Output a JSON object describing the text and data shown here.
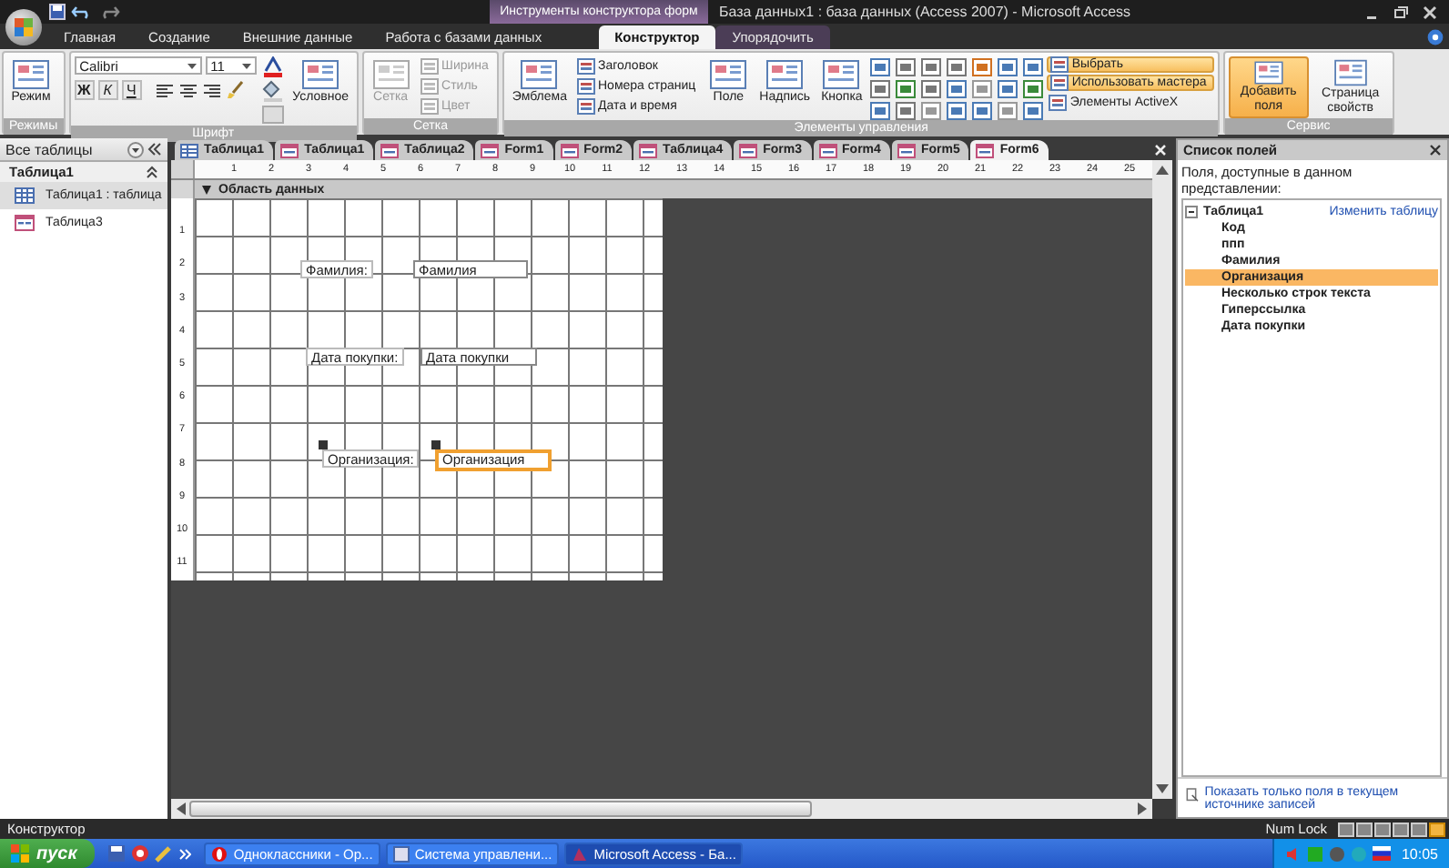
{
  "window": {
    "title": "База данных1 : база данных (Access 2007) - Microsoft Access",
    "contextual_group": "Инструменты конструктора форм"
  },
  "ribbon": {
    "tabs": [
      {
        "label": "Главная",
        "kind": "main",
        "selected": false
      },
      {
        "label": "Создание",
        "kind": "main",
        "selected": false
      },
      {
        "label": "Внешние данные",
        "kind": "main",
        "selected": false
      },
      {
        "label": "Работа с базами данных",
        "kind": "main",
        "selected": false
      },
      {
        "label": "Конструктор",
        "kind": "contextual",
        "selected": true
      },
      {
        "label": "Упорядочить",
        "kind": "contextual",
        "selected": false
      }
    ],
    "groups": [
      {
        "label": "Режимы",
        "items": [
          {
            "kind": "large",
            "label": "Режим",
            "on": false,
            "disabled": false
          }
        ]
      },
      {
        "label": "Шрифт",
        "items": [
          {
            "kind": "font",
            "font": "Calibri",
            "size": "11",
            "styles": [
              "Ж",
              "К",
              "Ч"
            ]
          },
          {
            "kind": "large",
            "label": "Условное",
            "on": false,
            "disabled": false
          }
        ]
      },
      {
        "label": "Сетка",
        "items": [
          {
            "kind": "large",
            "label": "Сетка",
            "on": false,
            "disabled": true
          },
          {
            "kind": "stack",
            "items": [
              {
                "label": "Ширина",
                "on": false,
                "disabled": true
              },
              {
                "label": "Стиль",
                "on": false,
                "disabled": true
              },
              {
                "label": "Цвет",
                "on": false,
                "disabled": true
              }
            ]
          }
        ]
      },
      {
        "label": "Элементы управления",
        "items": [
          {
            "kind": "large",
            "label": "Эмблема",
            "on": false,
            "disabled": false
          },
          {
            "kind": "stack",
            "items": [
              {
                "label": "Заголовок",
                "on": false,
                "disabled": false
              },
              {
                "label": "Номера страниц",
                "on": false,
                "disabled": false
              },
              {
                "label": "Дата и время",
                "on": false,
                "disabled": false
              }
            ]
          },
          {
            "kind": "large",
            "label": "Поле",
            "on": false,
            "disabled": false
          },
          {
            "kind": "large",
            "label": "Надпись",
            "on": false,
            "disabled": false
          },
          {
            "kind": "large",
            "label": "Кнопка",
            "on": false,
            "disabled": false
          },
          {
            "kind": "palette"
          },
          {
            "kind": "stack",
            "items": [
              {
                "label": "Выбрать",
                "on": true,
                "disabled": false
              },
              {
                "label": "Использовать мастера",
                "on": true,
                "disabled": false
              },
              {
                "label": "Элементы ActiveX",
                "on": false,
                "disabled": false
              }
            ]
          }
        ]
      },
      {
        "label": "Сервис",
        "items": [
          {
            "kind": "large",
            "label": "Добавить поля",
            "on": true,
            "disabled": false
          },
          {
            "kind": "large",
            "label": "Страница свойств",
            "on": false,
            "disabled": false
          }
        ]
      }
    ]
  },
  "nav": {
    "title": "Все таблицы",
    "group": "Таблица1",
    "items": [
      {
        "label": "Таблица1 : таблица",
        "kind": "table",
        "selected": true
      },
      {
        "label": "Таблица3",
        "kind": "form",
        "selected": false
      }
    ]
  },
  "doc_tabs": [
    {
      "label": "Таблица1",
      "kind": "table",
      "selected": false
    },
    {
      "label": "Таблица1",
      "kind": "form",
      "selected": false
    },
    {
      "label": "Таблица2",
      "kind": "form",
      "selected": false
    },
    {
      "label": "Form1",
      "kind": "form",
      "selected": false
    },
    {
      "label": "Form2",
      "kind": "form",
      "selected": false
    },
    {
      "label": "Таблица4",
      "kind": "form",
      "selected": false
    },
    {
      "label": "Form3",
      "kind": "form",
      "selected": false
    },
    {
      "label": "Form4",
      "kind": "form",
      "selected": false
    },
    {
      "label": "Form5",
      "kind": "form",
      "selected": false
    },
    {
      "label": "Form6",
      "kind": "form",
      "selected": true
    }
  ],
  "ruler": {
    "horizontal": [
      "1",
      "2",
      "3",
      "4",
      "5",
      "6",
      "7",
      "8",
      "9",
      "10",
      "11",
      "12",
      "13",
      "14",
      "15",
      "16",
      "17",
      "18",
      "19",
      "20",
      "21",
      "22",
      "23",
      "24",
      "25"
    ],
    "vertical": [
      "1",
      "2",
      "3",
      "4",
      "5",
      "6",
      "7",
      "8",
      "9",
      "10",
      "11"
    ]
  },
  "section": "Область данных",
  "form_controls": [
    {
      "kind": "label",
      "text": "Фамилия:",
      "selected": false
    },
    {
      "kind": "textbox",
      "text": "Фамилия",
      "selected": false
    },
    {
      "kind": "label",
      "text": "Дата покупки:",
      "selected": false
    },
    {
      "kind": "textbox",
      "text": "Дата покупки",
      "selected": false
    },
    {
      "kind": "label",
      "text": "Организация:",
      "selected": true
    },
    {
      "kind": "textbox",
      "text": "Организация",
      "selected": true
    }
  ],
  "field_list": {
    "title": "Список полей",
    "subtitle": "Поля, доступные в данном представлении:",
    "table": "Таблица1",
    "edit_link": "Изменить таблицу",
    "fields": [
      {
        "label": "Код",
        "selected": false
      },
      {
        "label": "ппп",
        "selected": false
      },
      {
        "label": "Фамилия",
        "selected": false
      },
      {
        "label": "Организация",
        "selected": true
      },
      {
        "label": "Несколько строк текста",
        "selected": false
      },
      {
        "label": "Гиперссылка",
        "selected": false
      },
      {
        "label": "Дата покупки",
        "selected": false
      }
    ],
    "footer_link": "Показать только поля в текущем источнике записей"
  },
  "status_bar": {
    "mode": "Конструктор",
    "indicator": "Num Lock"
  },
  "taskbar": {
    "start": "пуск",
    "tasks": [
      {
        "label": "Одноклассники - Ор...",
        "selected": false
      },
      {
        "label": "Система управлени...",
        "selected": false
      },
      {
        "label": "Microsoft Access - Ба...",
        "selected": true
      }
    ],
    "clock": "10:05"
  }
}
